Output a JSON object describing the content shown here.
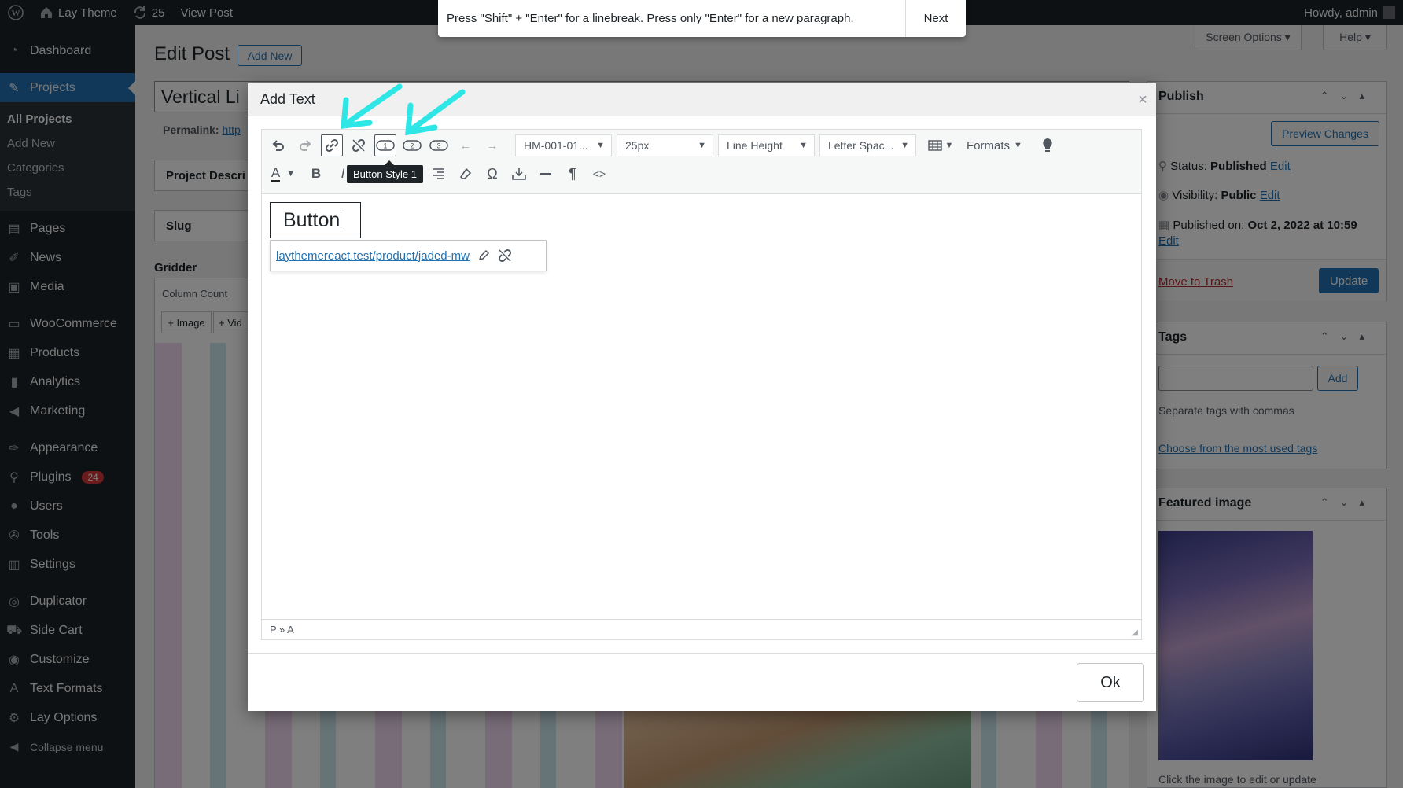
{
  "adminbar": {
    "site_name": "Lay Theme",
    "updates_count": "25",
    "view_post": "View Post",
    "howdy": "Howdy, admin"
  },
  "sidebar": {
    "items": [
      {
        "label": "Dashboard",
        "icon": "dashboard-icon"
      },
      {
        "label": "Projects",
        "icon": "pin-icon",
        "current": true
      },
      {
        "label": "Pages",
        "icon": "pages-icon"
      },
      {
        "label": "News",
        "icon": "news-icon"
      },
      {
        "label": "Media",
        "icon": "media-icon"
      },
      {
        "label": "WooCommerce",
        "icon": "woo-icon"
      },
      {
        "label": "Products",
        "icon": "products-icon"
      },
      {
        "label": "Analytics",
        "icon": "analytics-icon"
      },
      {
        "label": "Marketing",
        "icon": "megaphone-icon"
      },
      {
        "label": "Appearance",
        "icon": "brush-icon"
      },
      {
        "label": "Plugins",
        "icon": "plug-icon",
        "badge": "24"
      },
      {
        "label": "Users",
        "icon": "users-icon"
      },
      {
        "label": "Tools",
        "icon": "wrench-icon"
      },
      {
        "label": "Settings",
        "icon": "settings-icon"
      },
      {
        "label": "Duplicator",
        "icon": "duplicator-icon"
      },
      {
        "label": "Side Cart",
        "icon": "cart-icon"
      },
      {
        "label": "Customize",
        "icon": "eye-icon"
      },
      {
        "label": "Text Formats",
        "icon": "text-icon"
      },
      {
        "label": "Lay Options",
        "icon": "gear-icon"
      }
    ],
    "submenu": [
      "All Projects",
      "Add New",
      "Categories",
      "Tags"
    ],
    "collapse": "Collapse menu"
  },
  "main": {
    "title": "Edit Post",
    "add_new": "Add New",
    "post_title": "Vertical Li",
    "permalink_label": "Permalink:",
    "permalink_value": "http",
    "project_desc": "Project Descri",
    "slug": "Slug",
    "gridder": "Gridder",
    "column_count": "Column Count",
    "add_image": "+ Image",
    "add_video": "+ Vid"
  },
  "top_buttons": {
    "screen_options": "Screen Options ▾",
    "help": "Help ▾"
  },
  "publish": {
    "heading": "Publish",
    "preview": "Preview Changes",
    "status_label": "Status:",
    "status_value": "Published",
    "visibility_label": "Visibility:",
    "visibility_value": "Public",
    "published_label": "Published on:",
    "published_value": "Oct 2, 2022 at 10:59",
    "edit": "Edit",
    "trash": "Move to Trash",
    "update": "Update"
  },
  "tags_box": {
    "heading": "Tags",
    "add": "Add",
    "help": "Separate tags with commas",
    "choose": "Choose from the most used tags"
  },
  "featured": {
    "heading": "Featured image",
    "caption": "Click the image to edit or update"
  },
  "hint": {
    "text": "Press \"Shift\" + \"Enter\" for a linebreak. Press only \"Enter\" for a new paragraph.",
    "next": "Next"
  },
  "modal": {
    "title": "Add Text",
    "font_select": "HM-001-01...",
    "size_select": "25px",
    "line_height": "Line Height",
    "letter_spacing": "Letter Spac...",
    "formats": "Formats",
    "tooltip": "Button Style 1",
    "content_text": "Button",
    "link_url": "laythemereact.test/product/jaded-mw",
    "path": "P » A",
    "ok": "Ok"
  },
  "colors": {
    "accent": "#2271b1",
    "arrow": "#2ee6e6",
    "admin_dark": "#1d2327"
  }
}
